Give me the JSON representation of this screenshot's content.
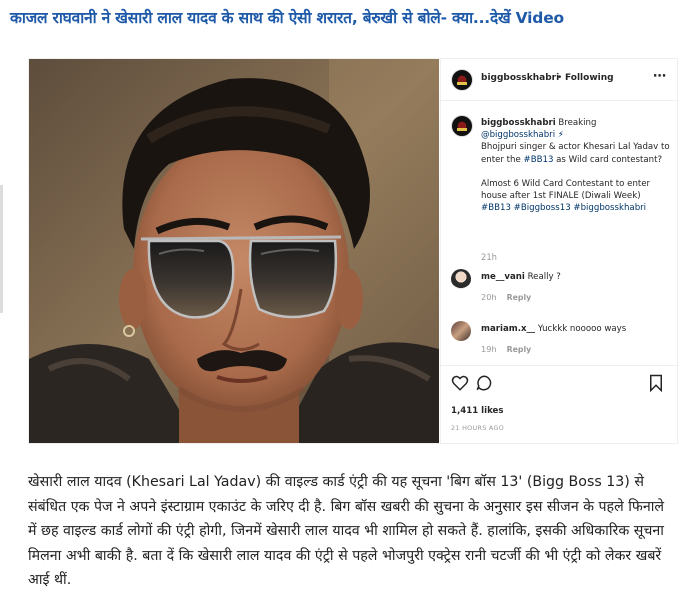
{
  "headline": "काजल राघवानी ने खेसारी लाल यादव के साथ की ऐसी शरारत, बेरुखी से बोले- क्या...देखें Video",
  "post": {
    "header": {
      "username": "biggbosskhabri",
      "separator": "•",
      "follow_label": "Following",
      "more_icon": "more-options-icon"
    },
    "caption": {
      "username": "biggbosskhabri",
      "line1": " Breaking",
      "mention": "@biggbosskhabri ⚡",
      "body": "Bhojpuri singer & actor Khesari Lal Yadav to enter the ",
      "body_tag": "#BB13",
      "body_end": " as Wild card contestant?",
      "para2": "Almost 6 Wild Card Contestant to enter house after 1st FINALE (Diwali Week)",
      "hashtags": "#BB13 #Biggboss13 #biggbosskhabri",
      "time": "21h"
    },
    "comments": [
      {
        "username": "me__vani",
        "text": " Really ?",
        "time": "20h",
        "reply": "Reply"
      },
      {
        "username": "mariam.x__",
        "text": " Yuckkk nooooo ways",
        "time": "19h",
        "reply": "Reply"
      }
    ],
    "likes": "1,411 likes",
    "posted_ago": "21 HOURS AGO"
  },
  "article": "खेसारी लाल यादव (Khesari Lal Yadav) की वाइल्ड कार्ड एंट्री की यह सूचना 'बिग बॉस 13' (Bigg Boss 13) से संबंधित एक पेज ने अपने इंस्टाग्राम एकाउंट के जरिए दी है. बिग बॉस खबरी की सुचना के अनुसार इस सीजन के पहले फिनाले में छह वाइल्ड कार्ड लोगों की एंट्री होगी, जिनमें खेसारी लाल यादव भी शामिल हो सकते हैं. हालांकि, इसकी अधिकारिक सूचना मिलना अभी बाकी है. बता दें कि खेसारी लाल यादव की एंट्री से पहले भोजपुरी एक्ट्रेस रानी चटर्जी की भी एंट्री को लेकर खबरें आई थीं.",
  "colors": {
    "headline": "#1e5aa8",
    "hashtag": "#003569",
    "muted": "#999999"
  }
}
